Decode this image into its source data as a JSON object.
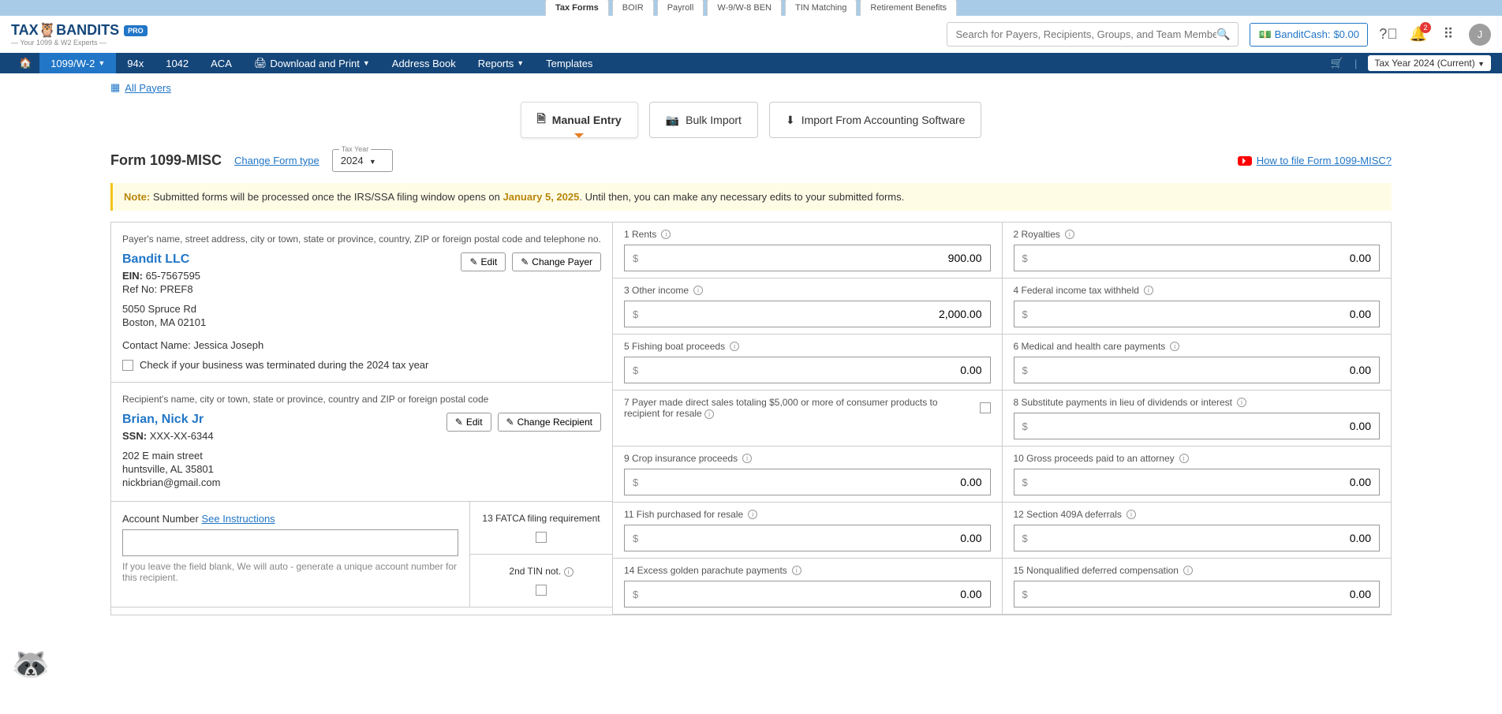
{
  "top_tabs": [
    "Tax Forms",
    "BOIR",
    "Payroll",
    "W-9/W-8 BEN",
    "TIN Matching",
    "Retirement Benefits"
  ],
  "logo": {
    "main": "TAX🦉BANDITS",
    "badge": "PRO",
    "sub": "— Your 1099 & W2 Experts —"
  },
  "search_placeholder": "Search for Payers, Recipients, Groups, and Team Members",
  "bandit_cash": {
    "label": "BanditCash:",
    "value": "$0.00"
  },
  "notif_count": "2",
  "avatar": "J",
  "nav": [
    "1099/W-2",
    "94x",
    "1042",
    "ACA",
    "Download and Print",
    "Address Book",
    "Reports",
    "Templates"
  ],
  "tax_year_top": "Tax Year 2024 (Current)",
  "all_payers": "All Payers",
  "entry_tabs": {
    "manual": "Manual Entry",
    "bulk": "Bulk Import",
    "acct": "Import From Accounting Software"
  },
  "form_title": "Form 1099-MISC",
  "change_form": "Change Form type",
  "tax_year_label": "Tax Year",
  "tax_year_value": "2024",
  "how_link": "How to file Form 1099-MISC?",
  "note": {
    "prefix": "Note:",
    "text_a": " Submitted forms will be processed once the IRS/SSA filing window opens on ",
    "date": "January 5, 2025",
    "text_b": ". Until then, you can make any necessary edits to your submitted forms."
  },
  "payer": {
    "section_label": "Payer's name, street address, city or town, state or province, country, ZIP or foreign postal code and telephone no.",
    "name": "Bandit LLC",
    "ein_label": "EIN:",
    "ein": "65-7567595",
    "ref_label": "Ref No:",
    "ref": "PREF8",
    "addr1": "5050 Spruce Rd",
    "addr2": "Boston, MA 02101",
    "contact_label": "Contact Name:",
    "contact": "Jessica Joseph",
    "chk_label": "Check if your business was terminated during the 2024 tax year",
    "edit": "Edit",
    "change": "Change Payer"
  },
  "recipient": {
    "section_label": "Recipient's name, city or town, state or province, country and ZIP or foreign postal code",
    "name": "Brian, Nick Jr",
    "ssn_label": "SSN:",
    "ssn": "XXX-XX-6344",
    "addr1": "202 E main street",
    "addr2": "huntsville, AL 35801",
    "email": "nickbrian@gmail.com",
    "edit": "Edit",
    "change": "Change Recipient"
  },
  "account": {
    "label": "Account Number",
    "see": "See Instructions",
    "hint": "If you leave the field blank, We will auto - generate a unique account number for this recipient."
  },
  "fatca": {
    "label": "13 FATCA filing requirement",
    "tin_label": "2nd TIN not."
  },
  "boxes": {
    "b1": {
      "label": "1   Rents",
      "value": "900.00"
    },
    "b2": {
      "label": "2   Royalties",
      "value": "0.00"
    },
    "b3": {
      "label": "3   Other income",
      "value": "2,000.00"
    },
    "b4": {
      "label": "4   Federal income tax withheld",
      "value": "0.00"
    },
    "b5": {
      "label": "5   Fishing boat proceeds",
      "value": "0.00"
    },
    "b6": {
      "label": "6   Medical and health care payments",
      "value": "0.00"
    },
    "b7": {
      "label": "7   Payer made direct sales totaling $5,000 or more of consumer products to recipient for resale"
    },
    "b8": {
      "label": "8   Substitute payments in lieu of dividends or interest",
      "value": "0.00"
    },
    "b9": {
      "label": "9   Crop insurance proceeds",
      "value": "0.00"
    },
    "b10": {
      "label": "10   Gross proceeds paid to an attorney",
      "value": "0.00"
    },
    "b11": {
      "label": "11   Fish purchased for resale",
      "value": "0.00"
    },
    "b12": {
      "label": "12   Section 409A deferrals",
      "value": "0.00"
    },
    "b14": {
      "label": "14   Excess golden parachute payments",
      "value": "0.00"
    },
    "b15": {
      "label": "15   Nonqualified deferred compensation",
      "value": "0.00"
    }
  }
}
